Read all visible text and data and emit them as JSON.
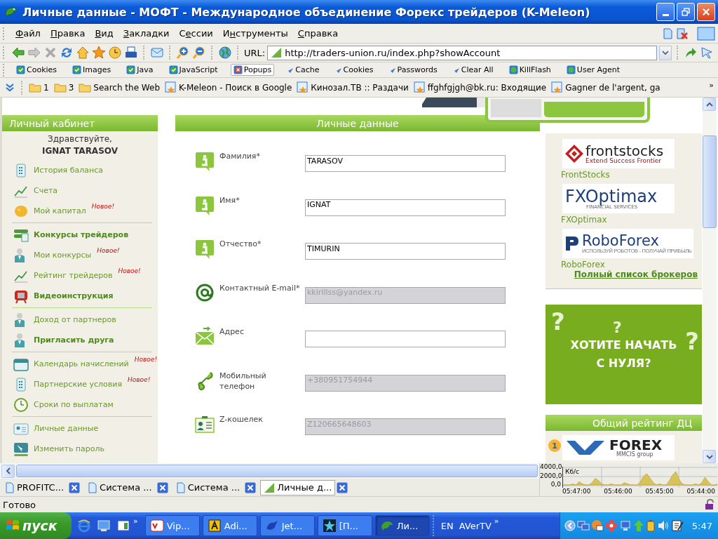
{
  "window": {
    "title": "Личные данные - МОФТ - Международное объединение Форекс трейдеров (K-Meleon)"
  },
  "menu": [
    {
      "segments": [
        {
          "text": "Ф",
          "underlined": true
        },
        {
          "text": "айл",
          "underlined": false
        }
      ]
    },
    {
      "segments": [
        {
          "text": "П",
          "underlined": true
        },
        {
          "text": "равка",
          "underlined": false
        }
      ]
    },
    {
      "segments": [
        {
          "text": "В",
          "underlined": true
        },
        {
          "text": "ид",
          "underlined": false
        }
      ]
    },
    {
      "segments": [
        {
          "text": "З",
          "underlined": true
        },
        {
          "text": "акладки",
          "underlined": false
        }
      ]
    },
    {
      "segments": [
        {
          "text": "С",
          "underlined": false
        },
        {
          "text": "е",
          "underlined": true
        },
        {
          "text": "ссии",
          "underlined": false
        }
      ]
    },
    {
      "segments": [
        {
          "text": "И",
          "underlined": false
        },
        {
          "text": "н",
          "underlined": true
        },
        {
          "text": "струменты",
          "underlined": false
        }
      ]
    },
    {
      "segments": [
        {
          "text": "С",
          "underlined": true
        },
        {
          "text": "правка",
          "underlined": false
        }
      ]
    }
  ],
  "address": {
    "label": "URL:",
    "value": "http://traders-union.ru/index.php?showAccount"
  },
  "privacy_bar": [
    {
      "label": "Cookies",
      "kind": "toggle",
      "on": true
    },
    {
      "label": "Images",
      "kind": "toggle",
      "on": true
    },
    {
      "label": "Java",
      "kind": "toggle",
      "on": true
    },
    {
      "label": "JavaScript",
      "kind": "toggle",
      "on": true
    },
    {
      "label": "Popups",
      "kind": "toggle",
      "on": false
    },
    {
      "label": "Cache",
      "kind": "action"
    },
    {
      "label": "Cookies",
      "kind": "action"
    },
    {
      "label": "Passwords",
      "kind": "action"
    },
    {
      "label": "Clear All",
      "kind": "action"
    },
    {
      "label": "KillFlash",
      "kind": "plugin"
    },
    {
      "label": "User Agent",
      "kind": "plugin"
    }
  ],
  "bookmarks": {
    "items": [
      {
        "label": "1",
        "kind": "folder"
      },
      {
        "label": "3",
        "kind": "folder"
      },
      {
        "label": "Search the Web",
        "kind": "folder"
      },
      {
        "label": "K-Meleon - Поиск в Google",
        "kind": "link"
      },
      {
        "label": "Кинозал.ТВ :: Раздачи",
        "kind": "link"
      },
      {
        "label": "ffghfgjgh@bk.ru: Входящие",
        "kind": "link"
      },
      {
        "label": "Gagner de l'argent, ga",
        "kind": "link"
      }
    ],
    "more": "»"
  },
  "sidebar": {
    "title": "Личный кабинет",
    "greeting": "Здравствуйте,",
    "user": "IGNAT TARASOV",
    "groups": [
      [
        {
          "label": "История баланса",
          "bold": false
        },
        {
          "label": "Счета",
          "bold": false
        },
        {
          "label": "Мой капитал",
          "bold": false,
          "badge": "Новое!"
        }
      ],
      [
        {
          "label": "Конкурсы трейдеров",
          "bold": true
        },
        {
          "label": "Мои конкурсы",
          "bold": false,
          "badge": "Новое!"
        },
        {
          "label": "Рейтинг трейдеров",
          "bold": false,
          "badge": "Новое!"
        },
        {
          "label": "Видеоинструкция",
          "bold": true
        }
      ],
      [
        {
          "label": "Доход от партнеров",
          "bold": false
        },
        {
          "label": "Пригласить друга",
          "bold": true
        }
      ],
      [
        {
          "label": "Календарь начислений",
          "bold": false,
          "badge": "Новое!"
        },
        {
          "label": "Партнерские условия",
          "bold": false,
          "badge": "Новое!"
        },
        {
          "label": "Сроки по выплатам",
          "bold": false
        }
      ],
      [
        {
          "label": "Личные данные",
          "bold": false
        },
        {
          "label": "Изменить пароль",
          "bold": false
        }
      ]
    ]
  },
  "form": {
    "title": "Личные данные",
    "fields": [
      {
        "label": "Фамилия*",
        "value": "TARASOV",
        "disabled": false
      },
      {
        "label": "Имя*",
        "value": "IGNAT",
        "disabled": false
      },
      {
        "label": "Отчество*",
        "value": "TIMURIN",
        "disabled": false
      },
      {
        "label": "Контактный E-mail*",
        "value": "kkirillss@yandex.ru",
        "disabled": true
      },
      {
        "label": "Адрес",
        "disabled": false
      },
      {
        "label": "Мобильный телефон",
        "value": "+380951754944",
        "disabled": true
      },
      {
        "label": "Z-кошелек",
        "value": "Z120665648603",
        "disabled": true
      }
    ]
  },
  "brokers": {
    "items": [
      {
        "name": "FrontStocks",
        "logo_text": "frontstocks",
        "logo_tagline": "Extend Success Frontier"
      },
      {
        "name": "FXOptimax",
        "logo_text": "FXOptimax",
        "logo_tagline": "FINANCIAL SERVICES"
      },
      {
        "name": "RoboForex",
        "logo_text": "RoboForex",
        "logo_tagline": "ИСПОЛЬЗУЙ РОБОТОВ - ПОЛУЧАЙ ПРИБЫЛЬ"
      }
    ],
    "all_link": "Полный список брокеров"
  },
  "promo": {
    "lines": [
      "ХОТИТЕ НАЧАТЬ",
      "С НУЛЯ?"
    ],
    "marks": [
      "?",
      "?",
      "?"
    ]
  },
  "rating": {
    "title": "Общий рейтинг ДЦ",
    "rank": "1",
    "logo_text": "FOREX",
    "logo_tagline": "MMCIS group"
  },
  "network_monitor": {
    "unit": "Кб/с",
    "y_labels": [
      "4000,0",
      "2000,0",
      "0,0"
    ],
    "x_labels": [
      "05:47:00",
      "05:46:00",
      "05:45:00",
      "05:44:00"
    ]
  },
  "tabs": [
    {
      "label": "PROFITC...",
      "selected": false
    },
    {
      "label": "Система ...",
      "selected": false
    },
    {
      "label": "Система ...",
      "selected": false
    },
    {
      "label": "Личные д...",
      "selected": true
    }
  ],
  "status_bar": {
    "text": "Готово"
  },
  "taskbar": {
    "start": "пуск",
    "quick_more": "»",
    "tasks": [
      {
        "label": "Vip...",
        "selected": false
      },
      {
        "label": "Adi...",
        "selected": false
      },
      {
        "label": "Jet...",
        "selected": false
      },
      {
        "label": "[П...",
        "selected": false
      },
      {
        "label": "Ли...",
        "selected": true
      }
    ],
    "language": "EN",
    "toolbar": "AVerTV",
    "toolbar_more": "»",
    "clock": "5:47"
  }
}
